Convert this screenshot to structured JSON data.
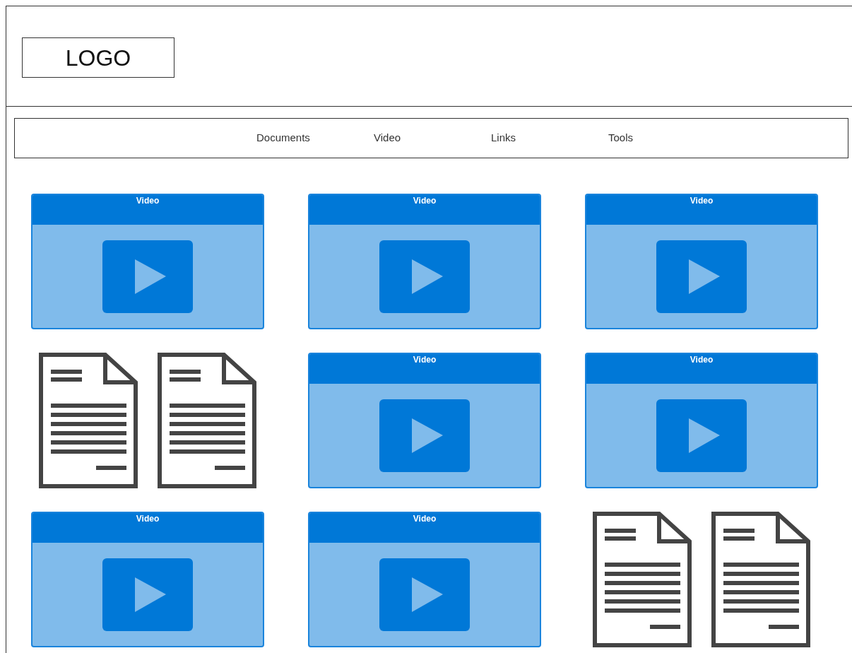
{
  "logo": "LOGO",
  "nav": [
    {
      "label": "Documents"
    },
    {
      "label": "Video"
    },
    {
      "label": "Links"
    },
    {
      "label": "Tools"
    }
  ],
  "tiles": [
    {
      "kind": "video",
      "title": "Video"
    },
    {
      "kind": "video",
      "title": "Video"
    },
    {
      "kind": "video",
      "title": "Video"
    },
    {
      "kind": "documents"
    },
    {
      "kind": "video",
      "title": "Video"
    },
    {
      "kind": "video",
      "title": "Video"
    },
    {
      "kind": "video",
      "title": "Video"
    },
    {
      "kind": "video",
      "title": "Video"
    },
    {
      "kind": "documents"
    }
  ]
}
